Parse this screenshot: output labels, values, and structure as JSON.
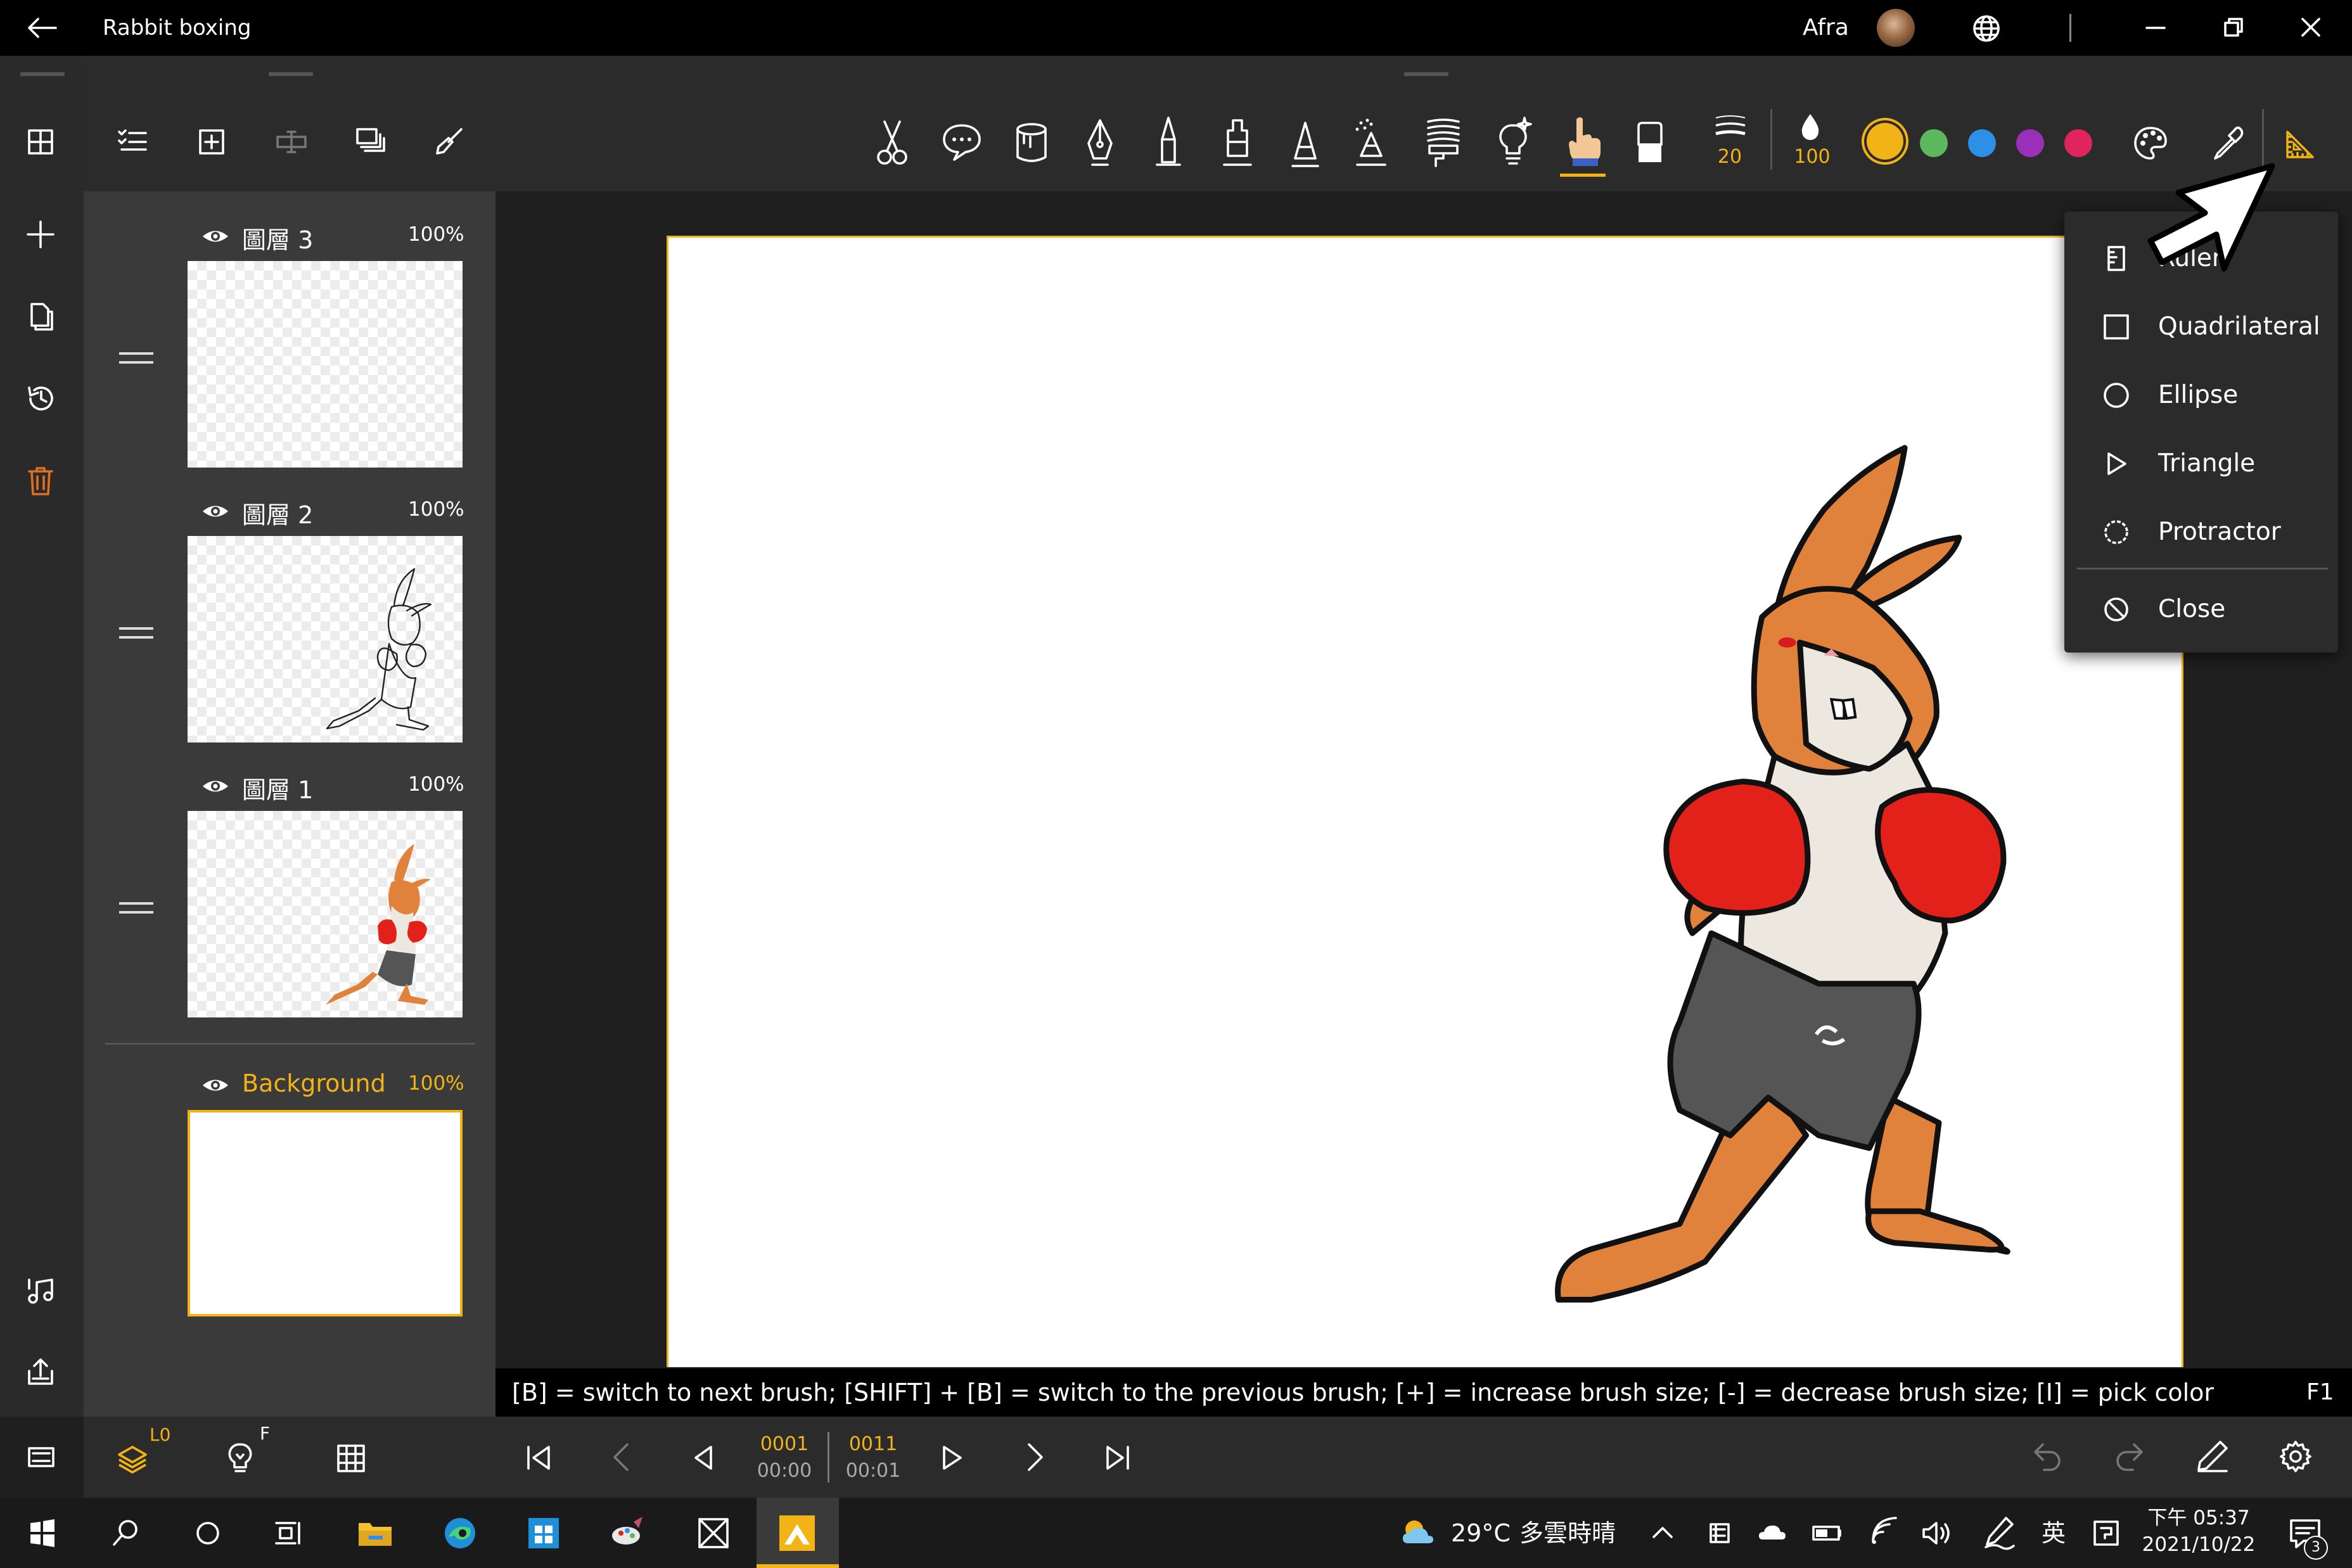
{
  "window": {
    "title": "Rabbit boxing",
    "user": "Afra"
  },
  "layers": {
    "items": [
      {
        "name": "圖層 3",
        "opacity": "100%"
      },
      {
        "name": "圖層 2",
        "opacity": "100%"
      },
      {
        "name": "圖層 1",
        "opacity": "100%"
      },
      {
        "name": "Background",
        "opacity": "100%"
      }
    ],
    "bottom": {
      "layer_badge": "L0",
      "onion_badge": "F"
    }
  },
  "toolbar": {
    "brush_size": "20",
    "opacity": "100",
    "colors": [
      "#f2b316",
      "#5cb85c",
      "#2f8fe6",
      "#9b30b8",
      "#e0245e"
    ]
  },
  "tools_menu": {
    "items": [
      "Ruler",
      "Quadrilateral",
      "Ellipse",
      "Triangle",
      "Protractor"
    ],
    "close": "Close"
  },
  "hint": {
    "text": "[B] = switch to next brush; [SHIFT] + [B] = switch to the previous brush; [+] = increase brush size; [-] = decrease brush size; [I] = pick color",
    "key": "F1"
  },
  "timeline": {
    "current_frame": "0001",
    "current_time": "00:00",
    "total_frames": "0011",
    "total_time": "00:01"
  },
  "taskbar": {
    "temperature": "29°C",
    "weather": "多雲時晴",
    "language": "英",
    "time": "下午 05:37",
    "date": "2021/10/22",
    "notifications": "3"
  }
}
